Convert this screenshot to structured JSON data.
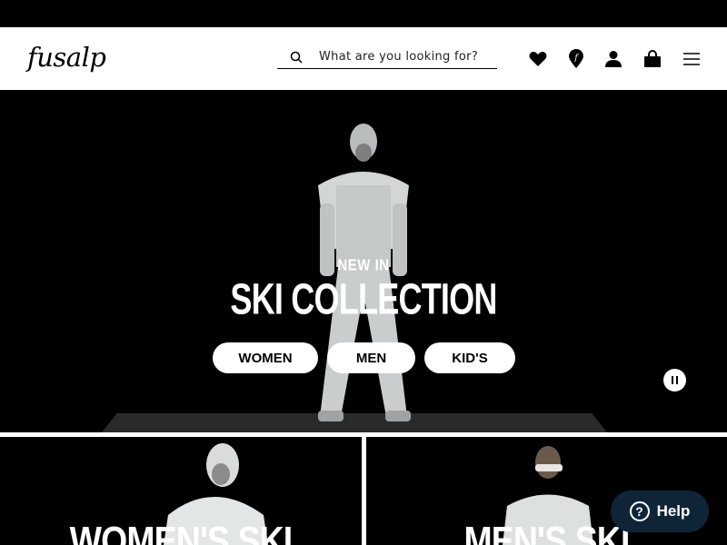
{
  "brand": {
    "logo": "fusalp"
  },
  "search": {
    "placeholder": "What are you looking for?"
  },
  "header_icons": [
    "heart-icon",
    "store-locator-icon",
    "account-icon",
    "bag-icon",
    "menu-icon"
  ],
  "hero": {
    "kicker": "NEW IN",
    "title": "SKI COLLECTION",
    "buttons": [
      {
        "label": "WOMEN"
      },
      {
        "label": "MEN"
      },
      {
        "label": "KID'S"
      }
    ]
  },
  "tiles": [
    {
      "title": "WOMEN'S SKI"
    },
    {
      "title": "MEN'S SKI"
    }
  ],
  "help": {
    "label": "Help",
    "glyph": "?"
  },
  "colors": {
    "accent": "#0f2537",
    "background": "#000000",
    "header": "#ffffff"
  }
}
